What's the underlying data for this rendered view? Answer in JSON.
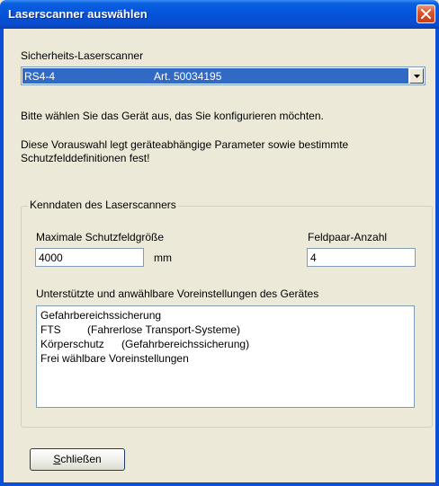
{
  "window": {
    "title": "Laserscanner auswählen"
  },
  "scanner": {
    "label": "Sicherheits-Laserscanner",
    "selected_name": "RS4-4",
    "selected_art": "Art. 50034195"
  },
  "instructions": {
    "line1": "Bitte wählen Sie das Gerät aus, das Sie konfigurieren möchten.",
    "line2a": "Diese Vorauswahl legt geräteabhängige Parameter sowie bestimmte",
    "line2b": "Schutzfelddefinitionen fest!"
  },
  "specs": {
    "group_title": "Kenndaten des Laserscanners",
    "max_field_label": "Maximale Schutzfeldgröße",
    "max_field_value": "4000",
    "max_field_unit": "mm",
    "pair_count_label": "Feldpaar-Anzahl",
    "pair_count_value": "4",
    "presets_label": "Unterstützte und anwählbare Voreinstellungen des Gerätes",
    "presets": [
      {
        "name": "Gefahrbereichssicherung",
        "desc": ""
      },
      {
        "name": "FTS",
        "desc": "(Fahrerlose Transport-Systeme)"
      },
      {
        "name": "Körperschutz",
        "desc": "(Gefahrbereichssicherung)"
      },
      {
        "name": "Frei wählbare Voreinstellungen",
        "desc": ""
      }
    ]
  },
  "buttons": {
    "close_first": "S",
    "close_rest": "chließen"
  }
}
